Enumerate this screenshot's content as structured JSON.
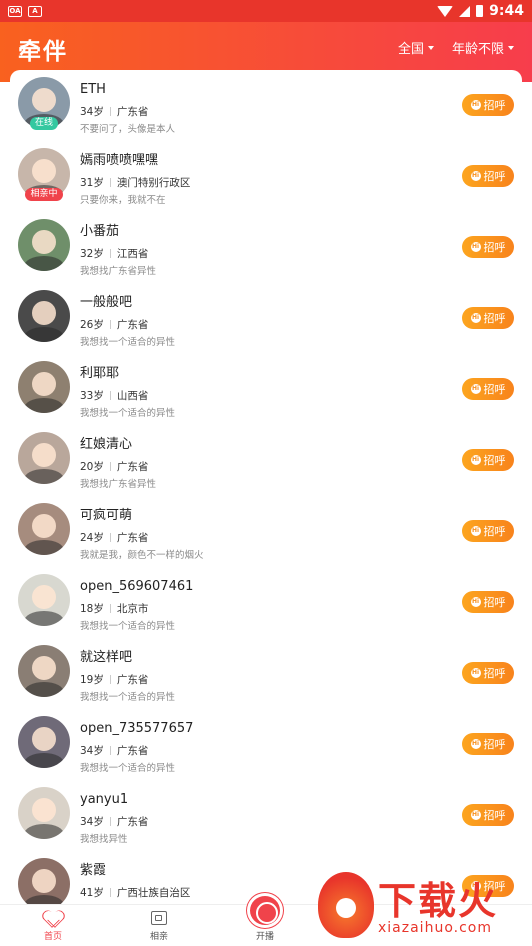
{
  "status_bar": {
    "time": "9:44",
    "notif_1": "OA",
    "notif_2": "A"
  },
  "header": {
    "title": "牵伴",
    "filter_region": "全国",
    "filter_age": "年龄不限"
  },
  "greet_label": "招呼",
  "greet_icon_text": "Hi",
  "users": [
    {
      "name": "ETH",
      "age": "34岁",
      "location": "广东省",
      "bio": "不要问了，头像是本人",
      "badge": "在线",
      "badge_type": "online",
      "avatar_bg": "#8a9aa8"
    },
    {
      "name": "嫣雨喷喷嘿嘿",
      "age": "31岁",
      "location": "澳门特别行政区",
      "bio": "只要你来，我就不在",
      "badge": "相亲中",
      "badge_type": "match",
      "avatar_bg": "#c7b6aa"
    },
    {
      "name": "小番茄",
      "age": "32岁",
      "location": "江西省",
      "bio": "我想找广东省异性",
      "badge": "",
      "badge_type": "",
      "avatar_bg": "#6f8f6a"
    },
    {
      "name": "一般般吧",
      "age": "26岁",
      "location": "广东省",
      "bio": "我想找一个适合的异性",
      "badge": "",
      "badge_type": "",
      "avatar_bg": "#4a4a4a"
    },
    {
      "name": "利耶耶",
      "age": "33岁",
      "location": "山西省",
      "bio": "我想找一个适合的异性",
      "badge": "",
      "badge_type": "",
      "avatar_bg": "#8e8070"
    },
    {
      "name": "红娘清心",
      "age": "20岁",
      "location": "广东省",
      "bio": "我想找广东省异性",
      "badge": "",
      "badge_type": "",
      "avatar_bg": "#b9a79b"
    },
    {
      "name": "可疯可萌",
      "age": "24岁",
      "location": "广东省",
      "bio": "我就是我，颜色不一样的烟火",
      "badge": "",
      "badge_type": "",
      "avatar_bg": "#a68c7e"
    },
    {
      "name": "open_569607461",
      "age": "18岁",
      "location": "北京市",
      "bio": "我想找一个适合的异性",
      "badge": "",
      "badge_type": "",
      "avatar_bg": "#d8d8d0"
    },
    {
      "name": "就这样吧",
      "age": "19岁",
      "location": "广东省",
      "bio": "我想找一个适合的异性",
      "badge": "",
      "badge_type": "",
      "avatar_bg": "#8a7e74"
    },
    {
      "name": "open_735577657",
      "age": "34岁",
      "location": "广东省",
      "bio": "我想找一个适合的异性",
      "badge": "",
      "badge_type": "",
      "avatar_bg": "#6f6a78"
    },
    {
      "name": "yanyu1",
      "age": "34岁",
      "location": "广东省",
      "bio": "我想找异性",
      "badge": "",
      "badge_type": "",
      "avatar_bg": "#d9d2c8"
    },
    {
      "name": "紫霞",
      "age": "41岁",
      "location": "广西壮族自治区",
      "bio": "",
      "badge": "",
      "badge_type": "",
      "avatar_bg": "#8c6f66"
    }
  ],
  "tabbar": {
    "home": "首页",
    "blind_date": "相亲",
    "live": "开播"
  },
  "watermark": {
    "main": "下载火",
    "sub": "xiazaihuo.com"
  },
  "colors": {
    "brand": "#f74b3a",
    "greet": "#f8901c",
    "online": "#34c8a0",
    "match": "#f0434b"
  }
}
